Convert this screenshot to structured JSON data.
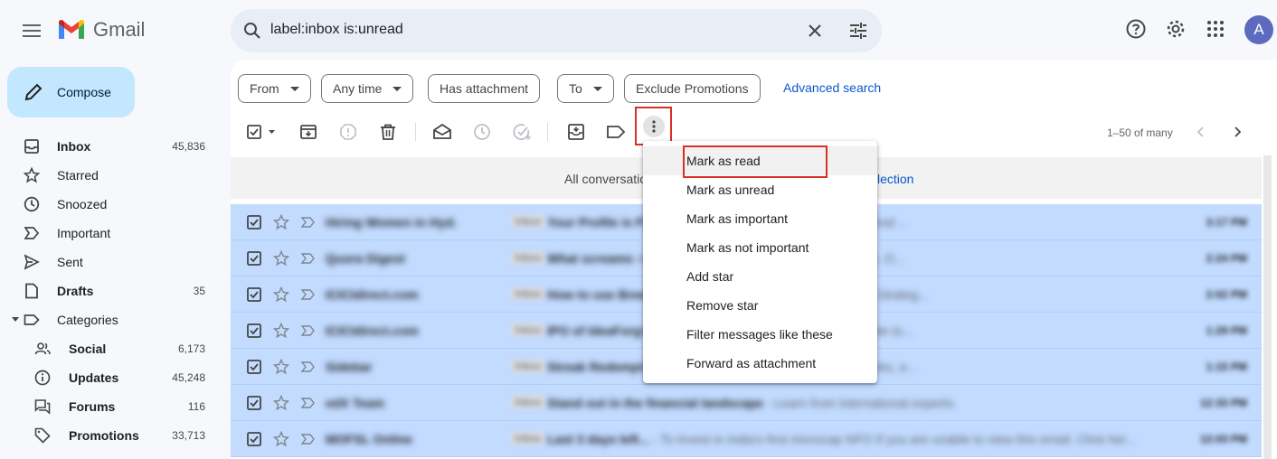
{
  "header": {
    "app_name": "Gmail",
    "search_query": "label:inbox is:unread",
    "avatar_letter": "A"
  },
  "sidebar": {
    "compose_label": "Compose",
    "items": [
      {
        "label": "Inbox",
        "count": "45,836",
        "icon": "inbox-icon",
        "bold": true
      },
      {
        "label": "Starred",
        "count": "",
        "icon": "star-icon",
        "bold": false
      },
      {
        "label": "Snoozed",
        "count": "",
        "icon": "clock-icon",
        "bold": false
      },
      {
        "label": "Important",
        "count": "",
        "icon": "important-icon",
        "bold": false
      },
      {
        "label": "Sent",
        "count": "",
        "icon": "send-icon",
        "bold": false
      },
      {
        "label": "Drafts",
        "count": "35",
        "icon": "draft-icon",
        "bold": true
      },
      {
        "label": "Categories",
        "count": "",
        "icon": "label-icon",
        "bold": false
      },
      {
        "label": "Social",
        "count": "6,173",
        "icon": "people-icon",
        "bold": true
      },
      {
        "label": "Updates",
        "count": "45,248",
        "icon": "info-icon",
        "bold": true
      },
      {
        "label": "Forums",
        "count": "116",
        "icon": "forum-icon",
        "bold": true
      },
      {
        "label": "Promotions",
        "count": "33,713",
        "icon": "tag-icon",
        "bold": true
      }
    ]
  },
  "filters": {
    "chips": [
      "From",
      "Any time",
      "Has attachment",
      "To",
      "Exclude Promotions"
    ],
    "advanced_search": "Advanced search"
  },
  "toolbar": {
    "pager_text": "1–50 of many"
  },
  "banner": {
    "left_text": "All conversatio",
    "right_text": "lection"
  },
  "menu": {
    "items": [
      "Mark as read",
      "Mark as unread",
      "Mark as important",
      "Mark as not important",
      "Add star",
      "Remove star",
      "Filter messages like these",
      "Forward as attachment"
    ]
  },
  "emails": [
    {
      "sender": "Hiring Women in Hyd.",
      "tag": "Inbox",
      "subject": "Your Profile is P",
      "snippet": "an Sachs, Jacobs, Micron, Jacobs, USP And ...",
      "time": "3:17 PM"
    },
    {
      "sender": "Quora Digest",
      "tag": "Inbox",
      "subject": "What screams ",
      "snippet": "net worth of several hundred million dollars. O...",
      "time": "2:24 PM"
    },
    {
      "sender": "ICICIdirect.com",
      "tag": "Inbox",
      "subject": "How to use Bree",
      "snippet": "API - How to use Breeze API for Options Strateg...",
      "time": "2:02 PM"
    },
    {
      "sender": "ICICIdirect.com",
      "tag": "Inbox",
      "subject": "IPO of IdeaForg",
      "snippet": "h 29th, 2023! - Know more If you are unable to...",
      "time": "1:29 PM"
    },
    {
      "sender": "Sidebar",
      "tag": "Inbox",
      "subject": "Streak Redempt",
      "snippet": "ns, Penpot Layouts - The 5 best design links, e...",
      "time": "1:15 PM"
    },
    {
      "sender": "edX Team",
      "tag": "Inbox",
      "subject": "Stand out in the financial landscape",
      "snippet": " - Learn from international experts.",
      "time": "12:33 PM"
    },
    {
      "sender": "MOFSL Online",
      "tag": "Inbox",
      "subject": "Last 3 days left...",
      "snippet": " - To invest in India's first microcap NFO If you are unable to view this email. Click her...",
      "time": "12:03 PM"
    }
  ]
}
